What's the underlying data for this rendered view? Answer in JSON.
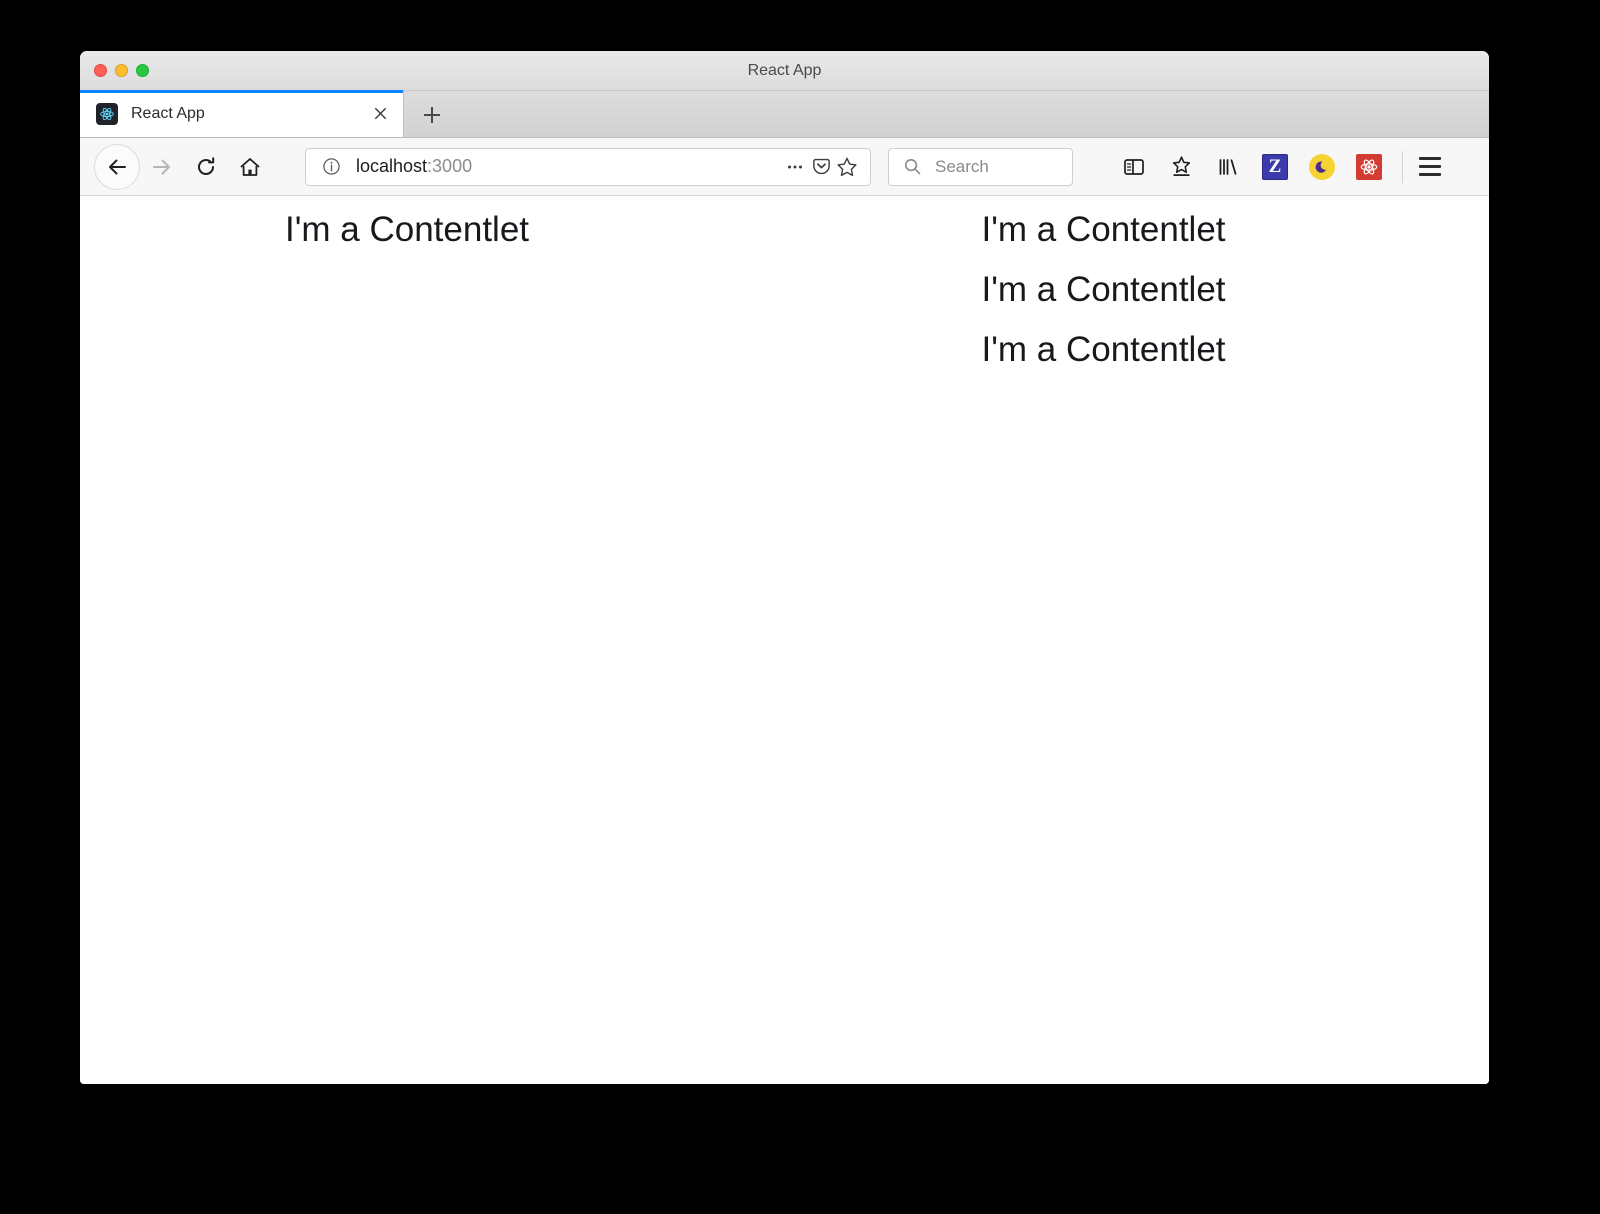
{
  "window": {
    "title": "React App",
    "traffic_lights": [
      {
        "name": "close",
        "color": "#ff5f57"
      },
      {
        "name": "minimize",
        "color": "#febc2e"
      },
      {
        "name": "maximize",
        "color": "#28c840"
      }
    ]
  },
  "tabs": [
    {
      "title": "React App",
      "favicon": "react-icon",
      "active": true,
      "close_label": "×"
    }
  ],
  "newtab": {
    "label": "+"
  },
  "nav": {
    "back": "back-arrow-icon",
    "forward": "forward-arrow-icon",
    "reload": "reload-icon",
    "home": "home-icon"
  },
  "urlbar": {
    "host": "localhost",
    "port": ":3000",
    "full": "localhost:3000",
    "info_icon": "info-circle-icon",
    "page_actions_icon": "ellipsis-icon",
    "pocket_icon": "pocket-icon",
    "bookmark_icon": "star-outline-icon"
  },
  "search": {
    "placeholder": "Search",
    "icon": "search-icon"
  },
  "extensions": [
    {
      "name": "sidebar-toggle-icon",
      "label": ""
    },
    {
      "name": "bookmark-star-icon",
      "label": ""
    },
    {
      "name": "library-icon",
      "label": ""
    },
    {
      "name": "zotero-icon",
      "label": "Z",
      "color": "#3b3bac"
    },
    {
      "name": "dark-mode-moon-icon",
      "label": "",
      "color": "#f6d332"
    },
    {
      "name": "react-devtools-icon",
      "label": "",
      "color": "#d43c33"
    }
  ],
  "menu": {
    "label": "hamburger-menu-icon"
  },
  "content": {
    "left_column": [
      {
        "text": "I'm a Contentlet"
      }
    ],
    "right_column": [
      {
        "text": "I'm a Contentlet"
      },
      {
        "text": "I'm a Contentlet"
      },
      {
        "text": "I'm a Contentlet"
      }
    ]
  },
  "colors": {
    "accent_blue": "#0a84ff",
    "page_background": "#ffffff",
    "desktop_background": "#000000",
    "text": "#17191c"
  }
}
